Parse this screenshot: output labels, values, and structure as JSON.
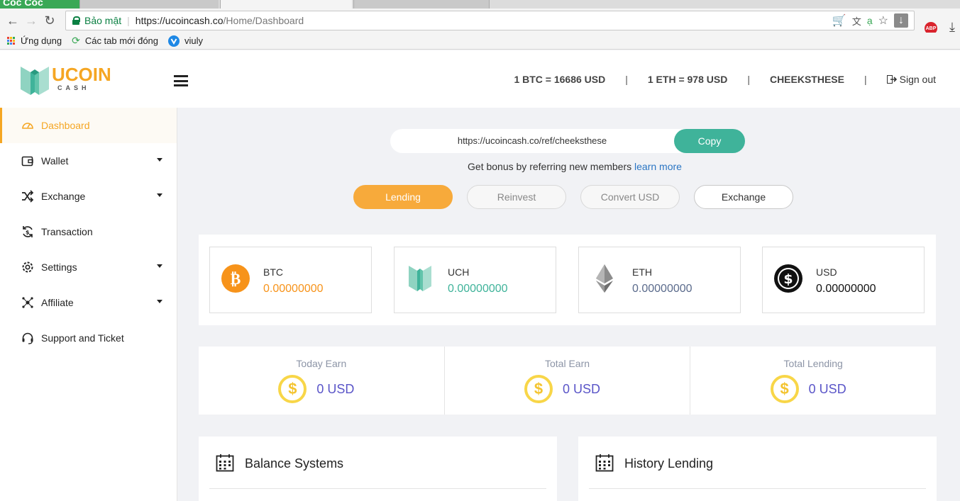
{
  "browser": {
    "tab_active_title": "Cốc Cốc",
    "secure_label": "Bảo mật",
    "url_host": "https://ucoincash.co",
    "url_path": "/Home/Dashboard",
    "bookmarks": [
      {
        "label": "Ứng dụng",
        "icon": "apps-grid-icon"
      },
      {
        "label": "Các tab mới đóng",
        "icon": "recent-tabs-icon"
      },
      {
        "label": "viuly",
        "icon": "viuly-icon"
      }
    ],
    "adblock_label": "ABP"
  },
  "header": {
    "logo_text": "COIN",
    "logo_initial": "U",
    "logo_sub": "CASH",
    "btc_rate": "1 BTC = 16686 USD",
    "eth_rate": "1 ETH = 978 USD",
    "username": "CHEEKSTHESE",
    "signout_label": "Sign out",
    "divider": "|"
  },
  "sidebar": {
    "items": [
      {
        "label": "Dashboard",
        "icon": "dashboard-gauge-icon",
        "active": true,
        "has_caret": false
      },
      {
        "label": "Wallet",
        "icon": "wallet-icon",
        "active": false,
        "has_caret": true
      },
      {
        "label": "Exchange",
        "icon": "shuffle-icon",
        "active": false,
        "has_caret": true
      },
      {
        "label": "Transaction",
        "icon": "transaction-icon",
        "active": false,
        "has_caret": false
      },
      {
        "label": "Settings",
        "icon": "gear-icon",
        "active": false,
        "has_caret": true
      },
      {
        "label": "Affiliate",
        "icon": "network-icon",
        "active": false,
        "has_caret": true
      },
      {
        "label": "Support and Ticket",
        "icon": "headset-icon",
        "active": false,
        "has_caret": false
      }
    ]
  },
  "referral": {
    "url": "https://ucoincash.co/ref/cheeksthese",
    "copy_label": "Copy",
    "bonus_text": "Get bonus by referring new members",
    "learn_more": "learn more"
  },
  "actions": {
    "lending": "Lending",
    "reinvest": "Reinvest",
    "convert_usd": "Convert USD",
    "exchange": "Exchange"
  },
  "coins": [
    {
      "name": "BTC",
      "value": "0.00000000",
      "color": "#f7931a",
      "icon": "bitcoin-icon"
    },
    {
      "name": "UCH",
      "value": "0.00000000",
      "color": "#3fb39a",
      "icon": "ucoin-icon"
    },
    {
      "name": "ETH",
      "value": "0.00000000",
      "color": "#5b6b8c",
      "icon": "ethereum-icon"
    },
    {
      "name": "USD",
      "value": "0.00000000",
      "color": "#111111",
      "icon": "dollar-icon"
    }
  ],
  "earnings": [
    {
      "label": "Today Earn",
      "value": "0 USD"
    },
    {
      "label": "Total Earn",
      "value": "0 USD"
    },
    {
      "label": "Total Lending",
      "value": "0 USD"
    }
  ],
  "usd_symbol": "$",
  "btc_symbol": "₿",
  "panels": {
    "balance_title": "Balance Systems",
    "history_title": "History Lending"
  },
  "colors": {
    "accent": "#f5a623",
    "teal": "#3fb39a",
    "earn_value": "#5a55c8"
  }
}
